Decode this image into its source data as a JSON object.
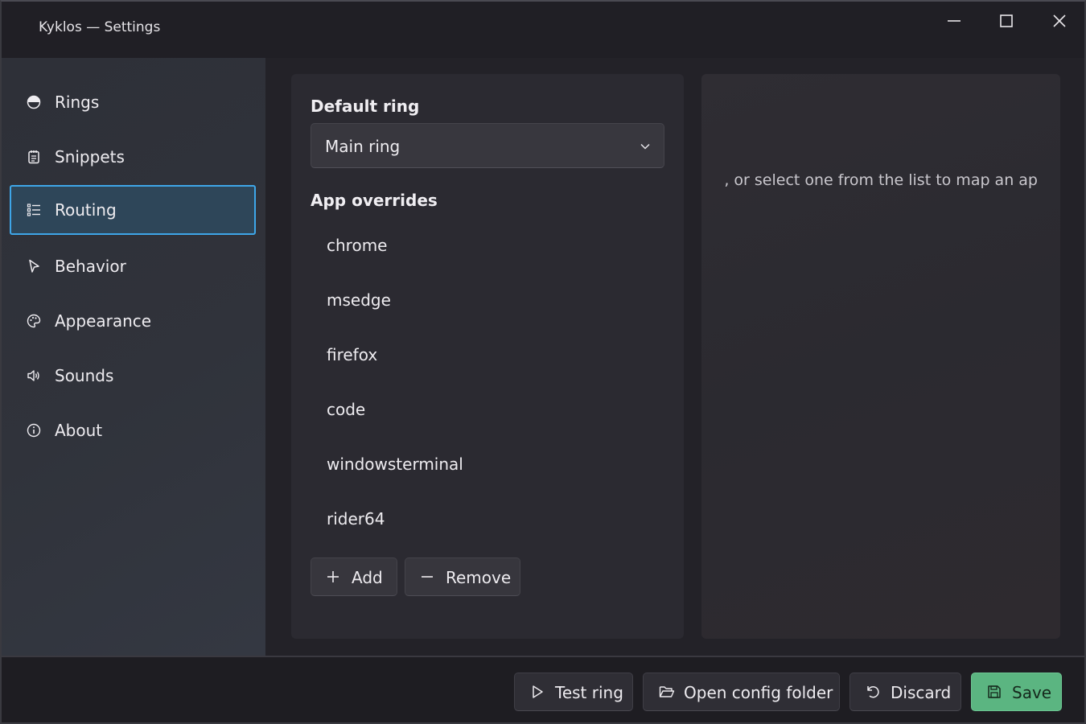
{
  "window": {
    "title": "Kyklos — Settings"
  },
  "sidebar": {
    "items": [
      {
        "label": "Rings",
        "icon": "ring-half-icon"
      },
      {
        "label": "Snippets",
        "icon": "notepad-icon"
      },
      {
        "label": "Routing",
        "icon": "list-icon",
        "active": true
      },
      {
        "label": "Behavior",
        "icon": "cursor-pointer-icon"
      },
      {
        "label": "Appearance",
        "icon": "palette-icon"
      },
      {
        "label": "Sounds",
        "icon": "speaker-icon"
      },
      {
        "label": "About",
        "icon": "info-icon"
      }
    ]
  },
  "routing": {
    "default_ring_title": "Default ring",
    "default_ring_value": "Main ring",
    "overrides_title": "App overrides",
    "overrides": [
      "chrome",
      "msedge",
      "firefox",
      "code",
      "windowsterminal",
      "rider64"
    ],
    "add_label": "Add",
    "remove_label": "Remove"
  },
  "detail": {
    "hint": "le, or select one from the list to map an ap"
  },
  "footer": {
    "test_ring_label": "Test ring",
    "open_config_label": "Open config folder",
    "discard_label": "Discard",
    "save_label": "Save"
  },
  "colors": {
    "accent": "#3ea6e8",
    "active_bg": "#2e4659",
    "save_bg": "#5bb581"
  }
}
